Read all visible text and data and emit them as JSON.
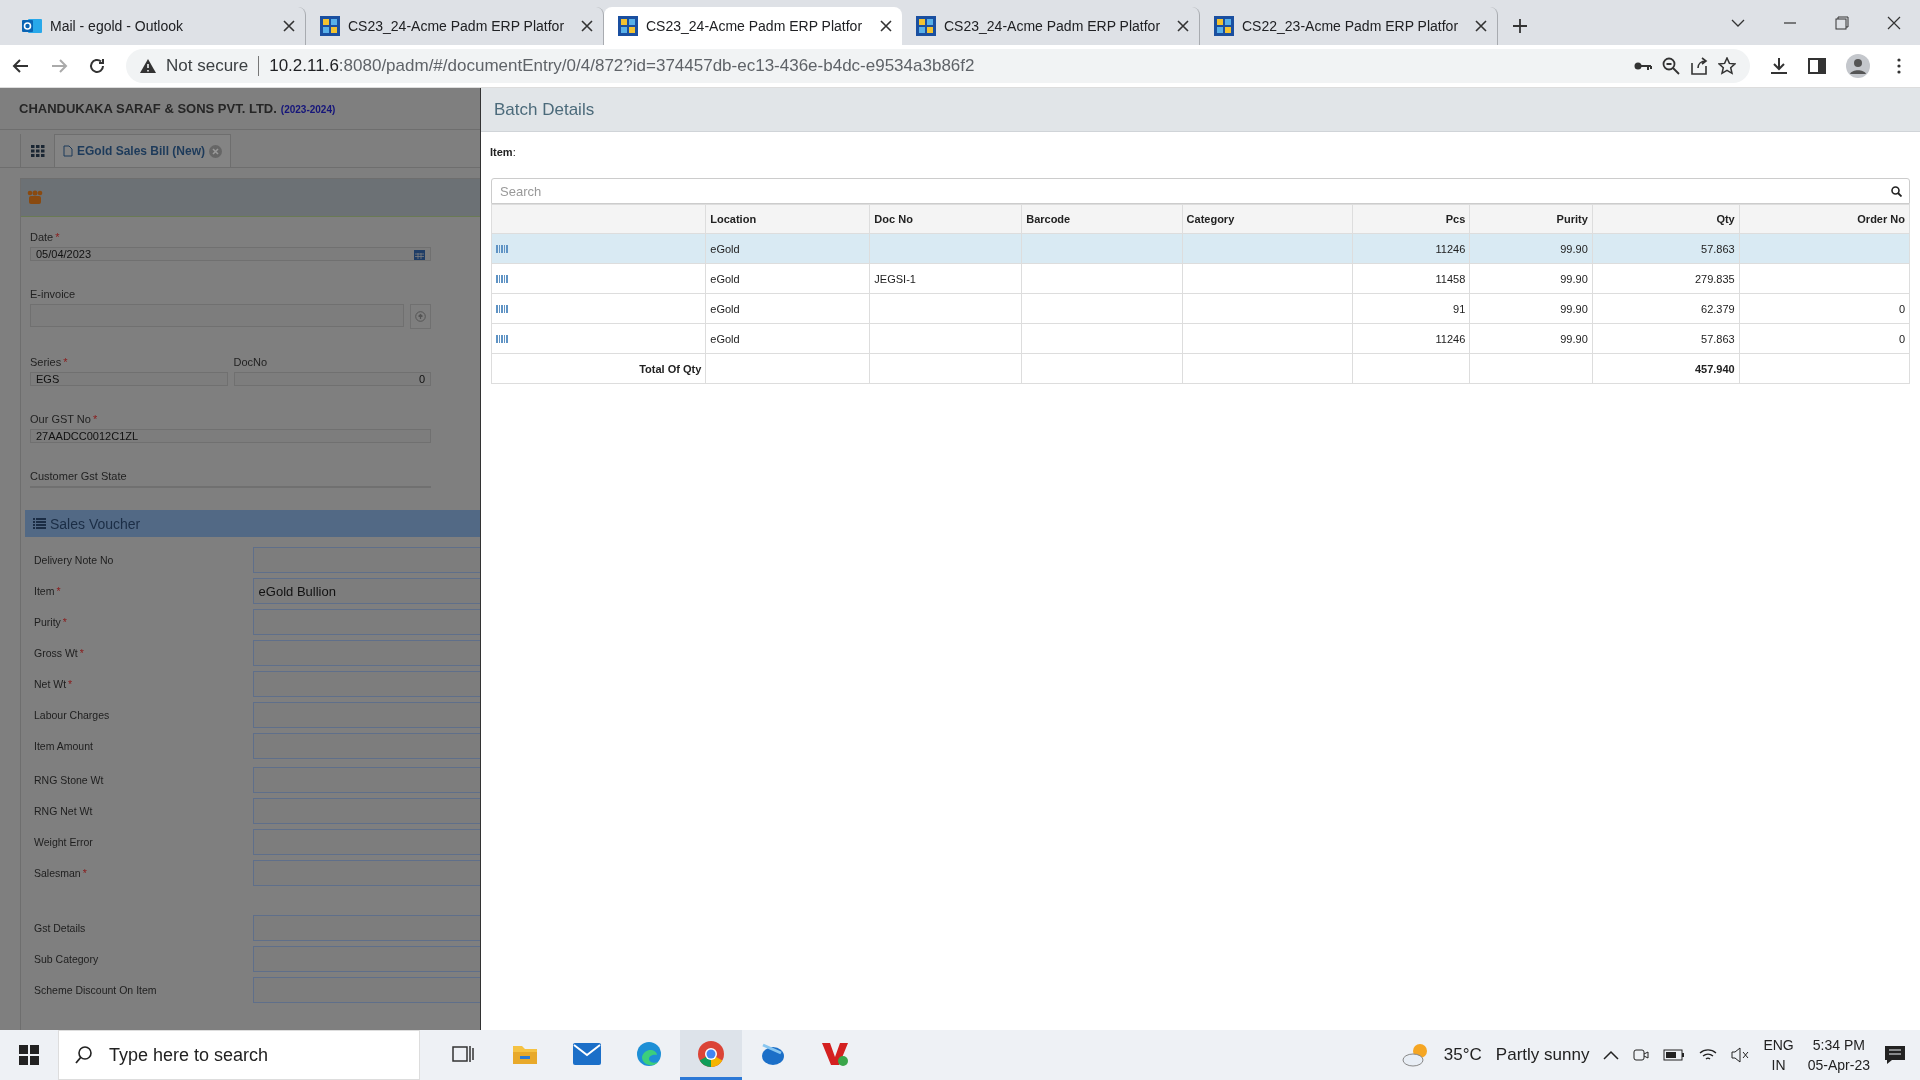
{
  "browser": {
    "tabs": [
      {
        "title": "Mail - egold - Outlook",
        "kind": "mail",
        "selected": false
      },
      {
        "title": "CS23_24-Acme Padm ERP Platfor",
        "kind": "erp",
        "selected": false
      },
      {
        "title": "CS23_24-Acme Padm ERP Platfor",
        "kind": "erp",
        "selected": true
      },
      {
        "title": "CS23_24-Acme Padm ERP Platfor",
        "kind": "erp",
        "selected": false
      },
      {
        "title": "CS22_23-Acme Padm ERP Platfor",
        "kind": "erp",
        "selected": false
      }
    ],
    "security": "Not secure",
    "url_host": "10.2.11.6",
    "url_rest": ":8080/padm/#/documentEntry/0/4/872?id=374457db-ec13-436e-b4dc-e9534a3b86f2"
  },
  "app": {
    "company": "CHANDUKAKA SARAF & SONS PVT. LTD.",
    "year": "(2023-2024)",
    "doc_tab": "EGold Sales Bill (New)",
    "required_mark": "*",
    "header_rows": [
      [
        {
          "label": "Date",
          "required": true,
          "value": "05/04/2023",
          "kind": "date"
        }
      ],
      [
        {
          "label": "E-invoice",
          "required": false,
          "kind": "upload"
        }
      ],
      [
        {
          "label": "Series",
          "required": true,
          "value": "EGS",
          "kind": "text"
        },
        {
          "label": "DocNo",
          "required": false,
          "value": "0",
          "kind": "number"
        }
      ],
      [
        {
          "label": "Our GST No",
          "required": true,
          "value": "27AADCC0012C1ZL",
          "kind": "text"
        }
      ],
      [
        {
          "label": "Customer Gst State",
          "required": false,
          "kind": "text"
        }
      ]
    ],
    "section": "Sales Voucher",
    "voucher_fields": [
      {
        "label": "Delivery Note No",
        "required": false
      },
      {
        "label": "Item",
        "required": true,
        "value": "eGold Bullion"
      },
      {
        "label": "Purity",
        "required": true
      },
      {
        "label": "Gross Wt",
        "required": true
      },
      {
        "label": "Net Wt",
        "required": true
      },
      {
        "label": "Labour Charges",
        "required": false
      },
      {
        "label": "Item Amount",
        "required": false
      },
      {
        "label": "RNG Stone Wt",
        "required": false
      },
      {
        "label": "RNG Net Wt",
        "required": false
      },
      {
        "label": "Weight Error",
        "required": false
      },
      {
        "label": "Salesman",
        "required": true
      },
      {
        "label": "Gst Details",
        "required": false
      },
      {
        "label": "Sub Category",
        "required": false
      },
      {
        "label": "Scheme Discount On Item",
        "required": false
      }
    ]
  },
  "dialog": {
    "title": "Batch Details",
    "item_label": "Item",
    "item_colon": ":",
    "search_placeholder": "Search",
    "columns": [
      "Location",
      "Doc No",
      "Barcode",
      "Category",
      "Pcs",
      "Purity",
      "Qty",
      "Order No"
    ],
    "rows": [
      {
        "selected": true,
        "location": "eGold",
        "pcs": "11246",
        "purity": "99.90",
        "qty": "57.863"
      },
      {
        "selected": false,
        "location": "eGold",
        "doc_no": "JEGSI-1",
        "pcs": "11458",
        "purity": "99.90",
        "qty": "279.835"
      },
      {
        "selected": false,
        "location": "eGold",
        "pcs": "91",
        "purity": "99.90",
        "qty": "62.379",
        "order_no": "0"
      },
      {
        "selected": false,
        "location": "eGold",
        "pcs": "11246",
        "purity": "99.90",
        "qty": "57.863",
        "order_no": "0"
      }
    ],
    "total_label": "Total Of Qty",
    "total_qty": "457.940"
  },
  "taskbar": {
    "search_placeholder": "Type here to search",
    "temperature": "35°C",
    "weather": "Partly sunny",
    "lang": "ENG",
    "region": "IN",
    "time": "5:34 PM",
    "date": "05-Apr-23",
    "apps": [
      {
        "kind": "taskview",
        "active": false
      },
      {
        "kind": "folder",
        "active": false
      },
      {
        "kind": "mail",
        "active": false
      },
      {
        "kind": "edge",
        "active": false
      },
      {
        "kind": "chrome",
        "active": true
      },
      {
        "kind": "app",
        "active": false
      },
      {
        "kind": "v",
        "active": false
      }
    ]
  }
}
